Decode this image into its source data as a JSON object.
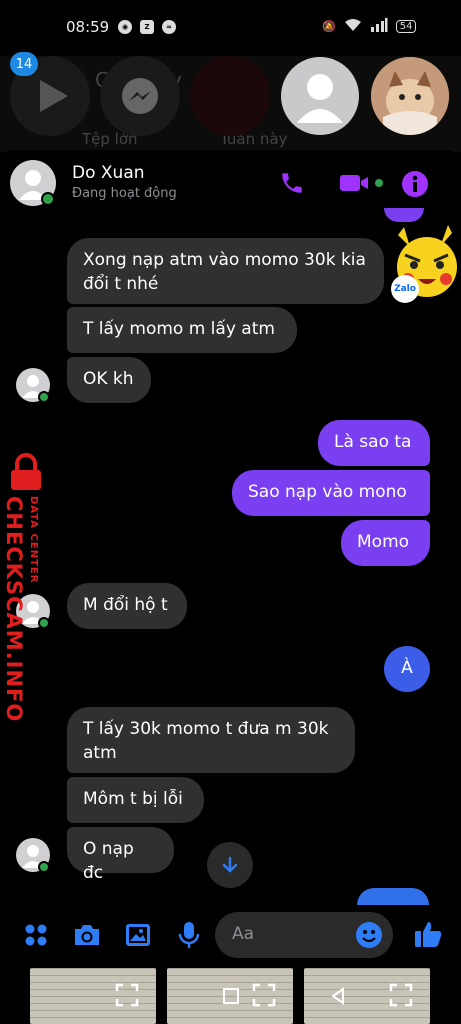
{
  "status_bar": {
    "time": "08:59",
    "battery": "54",
    "notif_icons": [
      "chrome-icon",
      "zalo-icon",
      "messenger-icon"
    ]
  },
  "chat_heads": {
    "badge_count": "14",
    "faded_texts": [
      "Gi",
      "y",
      "Tệp lớn",
      "Tuần này"
    ]
  },
  "header": {
    "contact_name": "Do Xuan",
    "contact_status": "Đang hoạt động"
  },
  "messages": [
    {
      "side": "in",
      "text": "Xong nạp atm vào momo 30k kia đổi t nhé"
    },
    {
      "side": "in",
      "text": "T lấy momo m lấy atm"
    },
    {
      "side": "in",
      "text": "OK kh"
    },
    {
      "side": "out",
      "text": "Là sao ta"
    },
    {
      "side": "out",
      "text": "Sao nạp vào mono"
    },
    {
      "side": "out",
      "text": "Momo"
    },
    {
      "side": "in",
      "text": "M đổi hộ t"
    },
    {
      "side": "out",
      "text": "À"
    },
    {
      "side": "in",
      "text": "T lấy 30k momo t đưa m 30k atm"
    },
    {
      "side": "in",
      "text": "Môm t bị lỗi"
    },
    {
      "side": "in",
      "text": "O nạp đc"
    }
  ],
  "watermark": {
    "line1": "DATA CENTER",
    "line2": "CHECKSCAM.INFO"
  },
  "sticker_badge": "Zalo",
  "composer": {
    "placeholder": "Aa"
  },
  "colors": {
    "accent": "#a033ff",
    "outgoing": "#7b3ff2",
    "incoming": "#303030",
    "blue": "#2f7df6"
  }
}
